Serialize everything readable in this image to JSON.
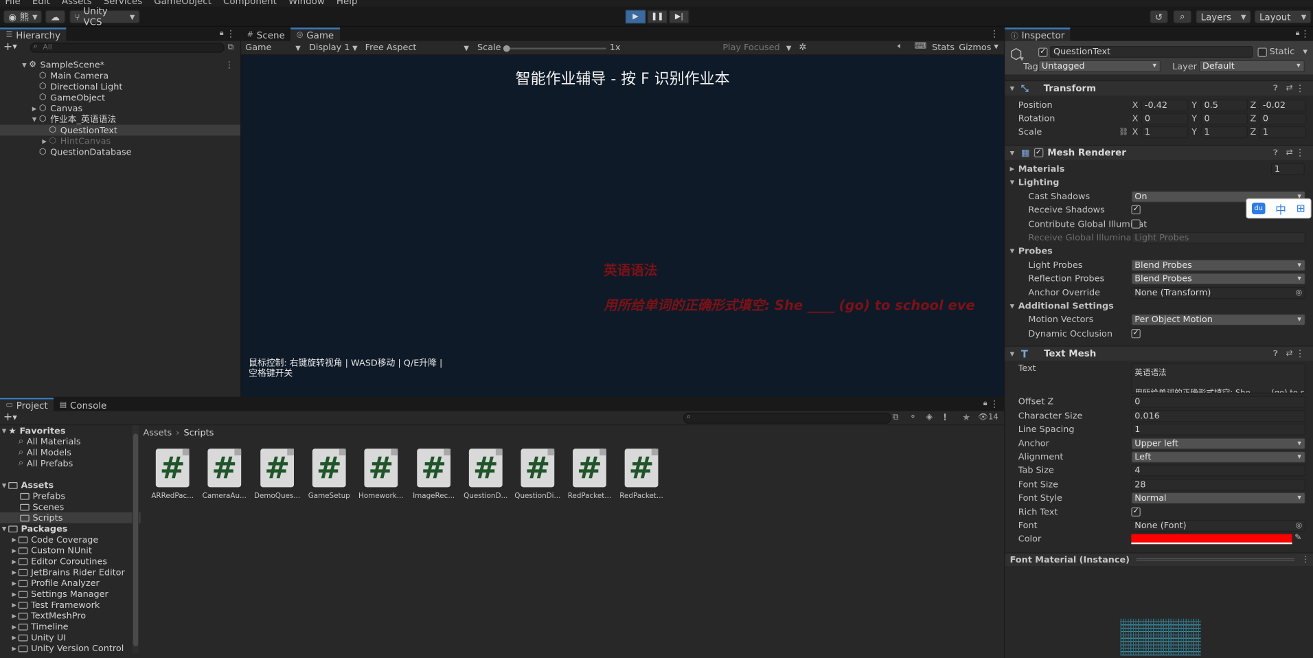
{
  "menubar": {
    "items": [
      "File",
      "Edit",
      "Assets",
      "Services",
      "GameObject",
      "Component",
      "Window",
      "Help"
    ]
  },
  "toolbar": {
    "account": "熊",
    "vcs": "Unity VCS",
    "layers": "Layers",
    "layout": "Layout"
  },
  "hierarchy": {
    "tab": "Hierarchy",
    "search_placeholder": "All",
    "items": [
      {
        "label": "SampleScene*",
        "icon": "unity-scene-icon"
      },
      {
        "label": "Main Camera",
        "icon": "gameobject-icon"
      },
      {
        "label": "Directional Light",
        "icon": "gameobject-icon"
      },
      {
        "label": "GameObject",
        "icon": "gameobject-icon"
      },
      {
        "label": "Canvas",
        "icon": "gameobject-icon"
      },
      {
        "label": "作业本_英语语法",
        "icon": "gameobject-icon"
      },
      {
        "label": "QuestionText",
        "icon": "gameobject-icon"
      },
      {
        "label": "HintCanvas",
        "icon": "gameobject-icon"
      },
      {
        "label": "QuestionDatabase",
        "icon": "gameobject-icon"
      }
    ]
  },
  "scene_tabs": {
    "scene": "Scene",
    "game": "Game"
  },
  "game_toolbar": {
    "mode": "Game",
    "display": "Display 1",
    "aspect": "Free Aspect",
    "scale_label": "Scale",
    "scale_value": "1x",
    "play_focused": "Play Focused",
    "stats": "Stats",
    "gizmos": "Gizmos"
  },
  "game_view": {
    "title": "智能作业辅导 - 按 F 识别作业本",
    "red_title": "英语语法",
    "red_question": "用所给单词的正确形式填空: She ____ (go) to school eve",
    "controls_line1": "鼠标控制: 右键旋转视角 | WASD移动 | Q/E升降 |",
    "controls_line2": "空格键开关",
    "bg_color": "#0e1a28",
    "red_color": "#7d1116"
  },
  "inspector": {
    "tab": "Inspector",
    "object_name": "QuestionText",
    "static_label": "Static",
    "tag_label": "Tag",
    "tag_value": "Untagged",
    "layer_label": "Layer",
    "layer_value": "Default",
    "transform": {
      "title": "Transform",
      "position_label": "Position",
      "rotation_label": "Rotation",
      "scale_label": "Scale",
      "position": [
        "-0.42",
        "0.5",
        "-0.02"
      ],
      "rotation": [
        "0",
        "0",
        "0"
      ],
      "scale": [
        "1",
        "1",
        "1"
      ]
    },
    "mesh_renderer": {
      "title": "Mesh Renderer",
      "materials_label": "Materials",
      "materials_count": "1",
      "lighting": "Lighting",
      "cast_shadows_label": "Cast Shadows",
      "cast_shadows": "On",
      "receive_shadows_label": "Receive Shadows",
      "contribute_gi_label": "Contribute Global Illuminat",
      "receive_gi_label": "Receive Global Illuminatior",
      "receive_gi": "Light Probes",
      "probes": "Probes",
      "light_probes_label": "Light Probes",
      "light_probes": "Blend Probes",
      "reflection_probes_label": "Reflection Probes",
      "reflection_probes": "Blend Probes",
      "anchor_override_label": "Anchor Override",
      "anchor_override": "None (Transform)",
      "additional": "Additional Settings",
      "motion_vectors_label": "Motion Vectors",
      "motion_vectors": "Per Object Motion",
      "dynamic_occlusion_label": "Dynamic Occlusion"
    },
    "text_mesh": {
      "title": "Text Mesh",
      "text_label": "Text",
      "text_line1": "英语语法",
      "text_line2": "用所给单词的正确形式填空: She ____ (go) to sc",
      "offset_z_label": "Offset Z",
      "offset_z": "0",
      "char_size_label": "Character Size",
      "char_size": "0.016",
      "line_spacing_label": "Line Spacing",
      "line_spacing": "1",
      "anchor_label": "Anchor",
      "anchor": "Upper left",
      "alignment_label": "Alignment",
      "alignment": "Left",
      "tab_size_label": "Tab Size",
      "tab_size": "4",
      "font_size_label": "Font Size",
      "font_size": "28",
      "font_style_label": "Font Style",
      "font_style": "Normal",
      "rich_text_label": "Rich Text",
      "font_label": "Font",
      "font": "None (Font)",
      "color_label": "Color",
      "color": "#ff0000"
    },
    "font_material": "Font Material (Instance)",
    "ime": {
      "zh": "中"
    }
  },
  "project": {
    "tabs": [
      "Project",
      "Console"
    ],
    "breadcrumb": [
      "Assets",
      "Scripts"
    ],
    "hidden_count": "14",
    "favorites_title": "Favorites",
    "favorites": [
      "All Materials",
      "All Models",
      "All Prefabs"
    ],
    "assets_title": "Assets",
    "assets_folders": [
      "Prefabs",
      "Scenes",
      "Scripts"
    ],
    "packages_title": "Packages",
    "packages": [
      "Code Coverage",
      "Custom NUnit",
      "Editor Coroutines",
      "JetBrains Rider Editor",
      "Profile Analyzer",
      "Settings Manager",
      "Test Framework",
      "TextMeshPro",
      "Timeline",
      "Unity UI",
      "Unity Version Control"
    ],
    "scripts": [
      "ARRedPac...",
      "CameraAu...",
      "DemoQues...",
      "GameSetup",
      "Homework...",
      "ImageRec...",
      "QuestionD...",
      "QuestionDi...",
      "RedPacket...",
      "RedPacket..."
    ]
  }
}
